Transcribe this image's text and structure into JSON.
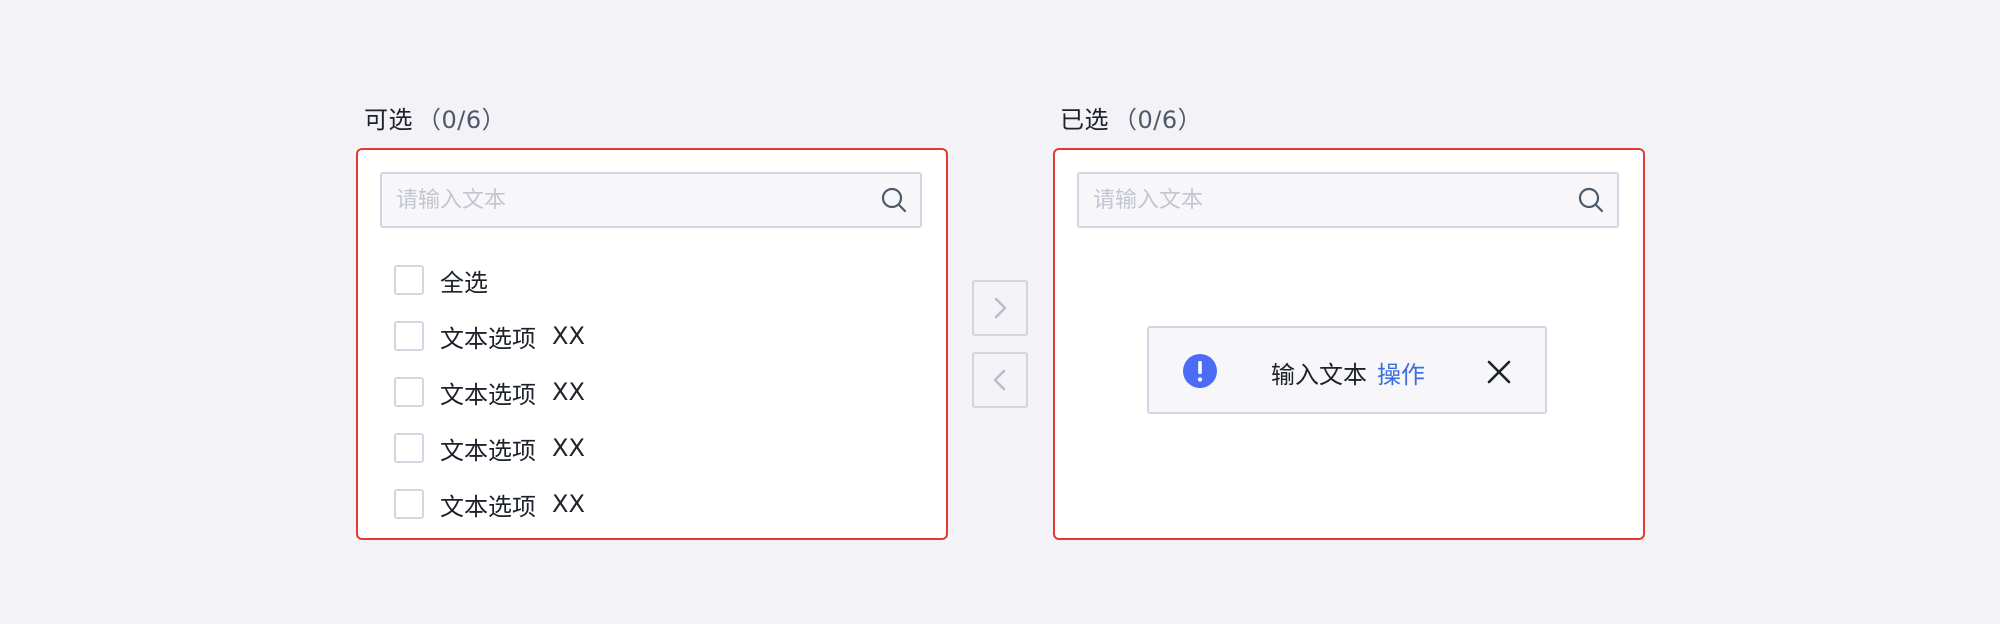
{
  "source_panel": {
    "title": "可选",
    "count": "（0/6）",
    "search_placeholder": "请输入文本",
    "select_all_label": "全选",
    "items": [
      {
        "label": "文本选项",
        "suffix": "XX"
      },
      {
        "label": "文本选项",
        "suffix": "XX"
      },
      {
        "label": "文本选项",
        "suffix": "XX"
      },
      {
        "label": "文本选项",
        "suffix": "XX"
      }
    ]
  },
  "target_panel": {
    "title": "已选",
    "count": "（0/6）",
    "search_placeholder": "请输入文本",
    "notice": {
      "text": "输入文本",
      "action": "操作"
    }
  },
  "transfer_buttons": {
    "move_right_icon": "chevron-right-icon",
    "move_left_icon": "chevron-left-icon"
  },
  "colors": {
    "panel_border": "#e23a2e",
    "info_icon": "#4a6cf7",
    "link": "#3b6fe0",
    "background": "#f2f2f7"
  }
}
